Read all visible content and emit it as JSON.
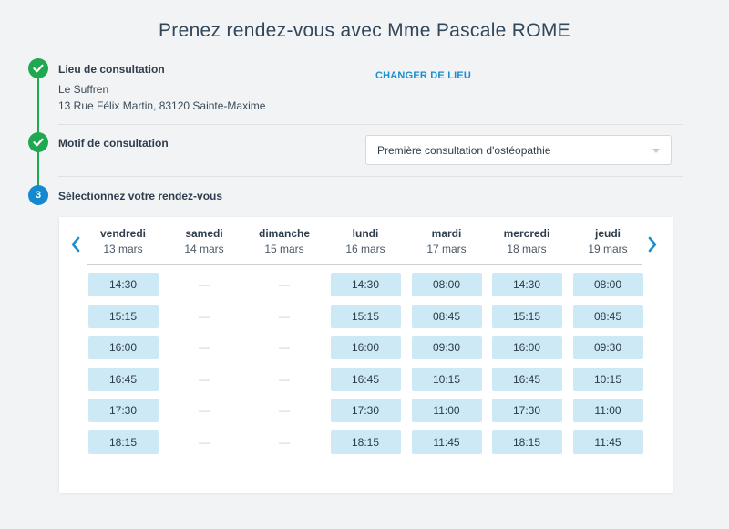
{
  "title": "Prenez rendez-vous avec Mme Pascale ROME",
  "steps": {
    "location": {
      "title": "Lieu de consultation",
      "place_name": "Le Suffren",
      "address": "13 Rue Félix Martin, 83120 Sainte-Maxime",
      "change_label": "CHANGER DE LIEU"
    },
    "reason": {
      "title": "Motif de consultation",
      "selected": "Première consultation d'ostéopathie"
    },
    "slot": {
      "number": "3",
      "title": "Sélectionnez votre rendez-vous"
    }
  },
  "colors": {
    "done": "#1fa84f",
    "current": "#1489d0",
    "slot_bg": "#cde9f6",
    "link": "#1a8fd0"
  },
  "calendar": {
    "days": [
      {
        "name": "vendredi",
        "date": "13 mars",
        "slots": [
          "14:30",
          "15:15",
          "16:00",
          "16:45",
          "17:30",
          "18:15"
        ]
      },
      {
        "name": "samedi",
        "date": "14 mars",
        "slots": [
          "—",
          "—",
          "—",
          "—",
          "—",
          "—"
        ]
      },
      {
        "name": "dimanche",
        "date": "15 mars",
        "slots": [
          "—",
          "—",
          "—",
          "—",
          "—",
          "—"
        ]
      },
      {
        "name": "lundi",
        "date": "16 mars",
        "slots": [
          "14:30",
          "15:15",
          "16:00",
          "16:45",
          "17:30",
          "18:15"
        ]
      },
      {
        "name": "mardi",
        "date": "17 mars",
        "slots": [
          "08:00",
          "08:45",
          "09:30",
          "10:15",
          "11:00",
          "11:45"
        ]
      },
      {
        "name": "mercredi",
        "date": "18 mars",
        "slots": [
          "14:30",
          "15:15",
          "16:00",
          "16:45",
          "17:30",
          "18:15"
        ]
      },
      {
        "name": "jeudi",
        "date": "19 mars",
        "slots": [
          "08:00",
          "08:45",
          "09:30",
          "10:15",
          "11:00",
          "11:45"
        ]
      }
    ]
  }
}
